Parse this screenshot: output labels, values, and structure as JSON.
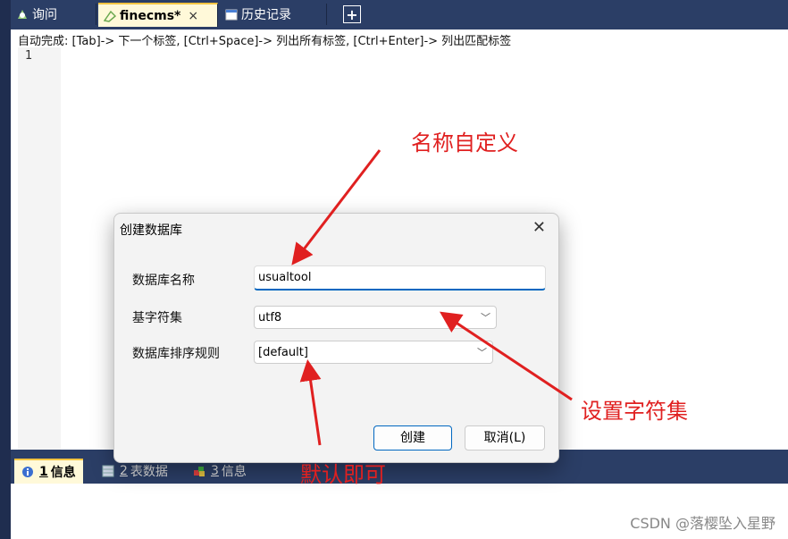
{
  "tabs": [
    {
      "label": "询问",
      "icon": "query-icon"
    },
    {
      "label": "finecms*",
      "icon": "table-design-icon",
      "close": "×"
    },
    {
      "label": "历史记录",
      "icon": "calendar-icon"
    }
  ],
  "add_tab_label": "+",
  "editor": {
    "hint": "自动完成: [Tab]-> 下一个标签, [Ctrl+Space]-> 列出所有标签, [Ctrl+Enter]-> 列出匹配标签",
    "line_number": "1"
  },
  "bottom_tabs": [
    {
      "num": "1",
      "label": "信息"
    },
    {
      "num": "2",
      "label": "表数据"
    },
    {
      "num": "3",
      "label": "信息"
    }
  ],
  "dialog": {
    "title": "创建数据库",
    "close": "✕",
    "name_label": "数据库名称",
    "name_value": "usualtool",
    "charset_label": "基字符集",
    "charset_value": "utf8",
    "collation_label": "数据库排序规则",
    "collation_value": "[default]",
    "create_button": "创建",
    "cancel_button": "取消(L)"
  },
  "annotations": {
    "name": "名称自定义",
    "charset": "设置字符集",
    "default": "默认即可"
  },
  "watermark": "CSDN @落樱坠入星野",
  "colors": {
    "annotation": "#e02020",
    "tab_bar": "#2b3e66",
    "active_tab": "#fff9d9",
    "accent": "#0067c0"
  }
}
